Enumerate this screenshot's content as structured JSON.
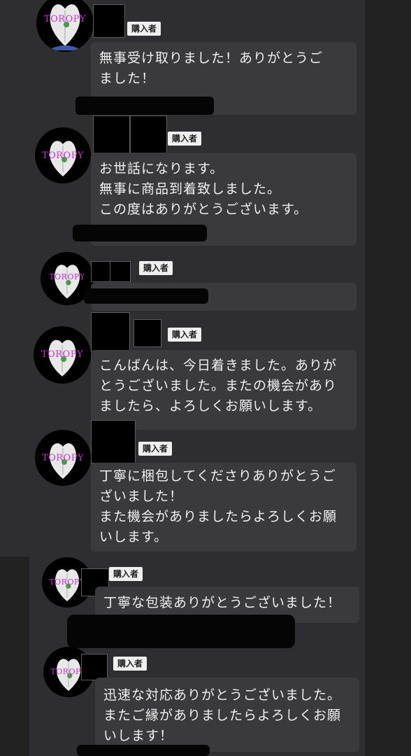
{
  "brand_text": "TOROPY",
  "colors": {
    "background": "#222222",
    "panel": "#2e2e30",
    "bubble": "#3a3a3c",
    "brand": "#cc2fd4",
    "badge_bg": "#efefef"
  },
  "reviews": [
    {
      "role_badge": "購入者",
      "lines": [
        "無事受け取りました！ありがとうご",
        "ました！"
      ]
    },
    {
      "role_badge": "購入者",
      "lines": [
        "お世話になります。",
        "無事に商品到着致しました。",
        "この度はありがとうございます。"
      ]
    },
    {
      "role_badge": "購入者",
      "lines": []
    },
    {
      "role_badge": "購入者",
      "lines": [
        "こんばんは、今日着きました。ありが",
        "とうございました。またの機会があり",
        "ましたら、よろしくお願いします。"
      ]
    },
    {
      "role_badge": "購入者",
      "lines": [
        "丁寧に梱包してくださりありがとうご",
        "ざいました！",
        "また機会がありましたらよろしくお願",
        "いします。"
      ]
    },
    {
      "role_badge": "購入者",
      "lines": [
        "丁寧な包装ありがとうございました！"
      ]
    },
    {
      "role_badge": "購入者",
      "lines": [
        "迅速な対応ありがとうございました。",
        "またご縁がありましたらよろしくお願",
        "いします！"
      ]
    }
  ]
}
